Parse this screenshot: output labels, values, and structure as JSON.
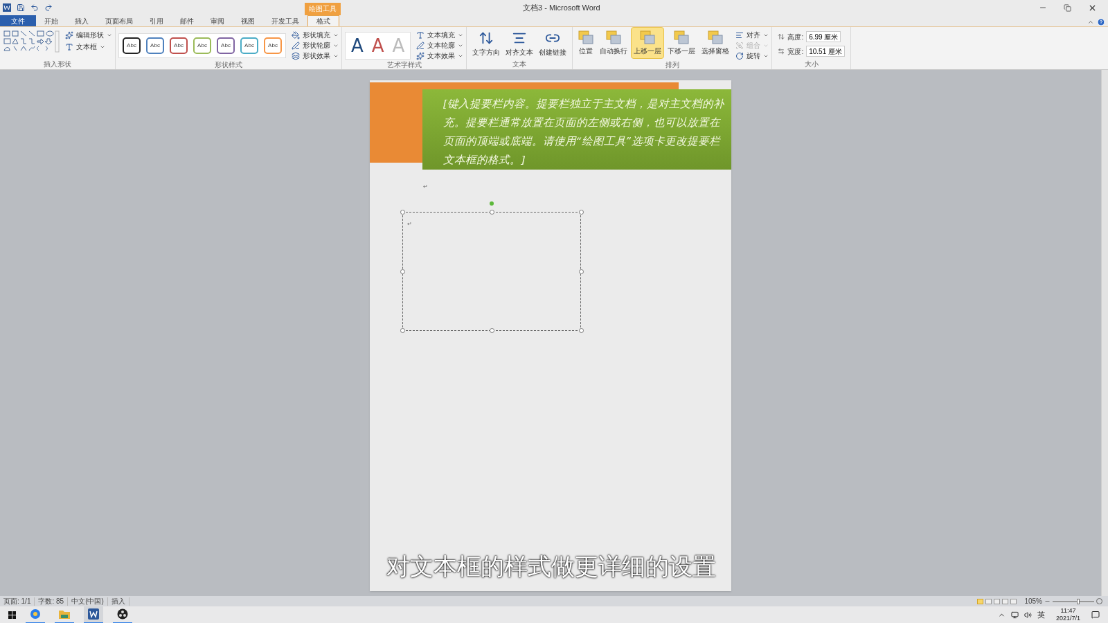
{
  "window": {
    "title": "文档3 - Microsoft Word",
    "context_tab": "绘图工具"
  },
  "tabs": [
    {
      "label": "文件",
      "selected": false,
      "kind": "file"
    },
    {
      "label": "开始",
      "selected": false,
      "kind": "normal"
    },
    {
      "label": "插入",
      "selected": false,
      "kind": "normal"
    },
    {
      "label": "页面布局",
      "selected": false,
      "kind": "normal"
    },
    {
      "label": "引用",
      "selected": false,
      "kind": "normal"
    },
    {
      "label": "邮件",
      "selected": false,
      "kind": "normal"
    },
    {
      "label": "审阅",
      "selected": false,
      "kind": "normal"
    },
    {
      "label": "视图",
      "selected": false,
      "kind": "normal"
    },
    {
      "label": "开发工具",
      "selected": false,
      "kind": "normal"
    },
    {
      "label": "格式",
      "selected": true,
      "kind": "context"
    }
  ],
  "ribbon": {
    "insert_shapes": {
      "label": "插入形状",
      "commands": [
        "编辑形状",
        "文本框"
      ]
    },
    "shape_styles": {
      "label": "形状样式",
      "swatches": [
        {
          "text": "Abc",
          "color": "#222222"
        },
        {
          "text": "Abc",
          "color": "#4f81bd"
        },
        {
          "text": "Abc",
          "color": "#c0504d"
        },
        {
          "text": "Abc",
          "color": "#9bbb59"
        },
        {
          "text": "Abc",
          "color": "#8064a2"
        },
        {
          "text": "Abc",
          "color": "#4bacc6"
        },
        {
          "text": "Abc",
          "color": "#f79646"
        }
      ],
      "commands": [
        "形状填充",
        "形状轮廓",
        "形状效果"
      ]
    },
    "wordart_styles": {
      "label": "艺术字样式",
      "letters": [
        {
          "text": "A",
          "color": "#1f497d"
        },
        {
          "text": "A",
          "color": "#c0504d"
        },
        {
          "text": "A",
          "color": "#bbbbbb"
        }
      ],
      "commands": [
        "文本填充",
        "文本轮廓",
        "文本效果"
      ]
    },
    "text": {
      "label": "文本",
      "buttons": [
        "文字方向",
        "对齐文本",
        "创建链接"
      ]
    },
    "arrange": {
      "label": "排列",
      "buttons": [
        {
          "label": "位置",
          "selected": false
        },
        {
          "label": "自动换行",
          "selected": false
        },
        {
          "label": "上移一层",
          "selected": true
        },
        {
          "label": "下移一层",
          "selected": false
        },
        {
          "label": "选择窗格",
          "selected": false
        }
      ],
      "small": [
        {
          "label": "对齐",
          "disabled": false
        },
        {
          "label": "组合",
          "disabled": true
        },
        {
          "label": "旋转",
          "disabled": false
        }
      ]
    },
    "size": {
      "label": "大小",
      "fields": [
        {
          "label": "高度:",
          "value": "6.99 厘米"
        },
        {
          "label": "宽度:",
          "value": "10.51 厘米"
        }
      ]
    }
  },
  "document": {
    "sidebar_text": "[键入提要栏内容。提要栏独立于主文档，是对主文档的补充。提要栏通常放置在页面的左侧或右侧，也可以放置在页面的顶端或底端。请使用“绘图工具”选项卡更改提要栏文本框的格式。]",
    "paragraph_mark": "↵",
    "textbox_mark": "↵",
    "caption": "对文本框的样式做更详细的设置"
  },
  "status_bar": {
    "items": [
      "页面: 1/1",
      "字数: 85",
      "中文(中国)",
      "插入"
    ],
    "views": [
      {
        "selected": true
      },
      {
        "selected": false
      },
      {
        "selected": false
      },
      {
        "selected": false
      },
      {
        "selected": false
      }
    ],
    "zoom": "105%",
    "zoom_slider": {
      "level": 0.62
    }
  },
  "taskbar": {
    "apps": [
      {
        "kind": "browser",
        "selected": false
      },
      {
        "kind": "folder",
        "selected": false
      },
      {
        "kind": "word",
        "selected": true
      },
      {
        "kind": "recorder",
        "selected": false
      }
    ],
    "ime": "英",
    "time": "11:47",
    "date": "2021/7/1"
  }
}
